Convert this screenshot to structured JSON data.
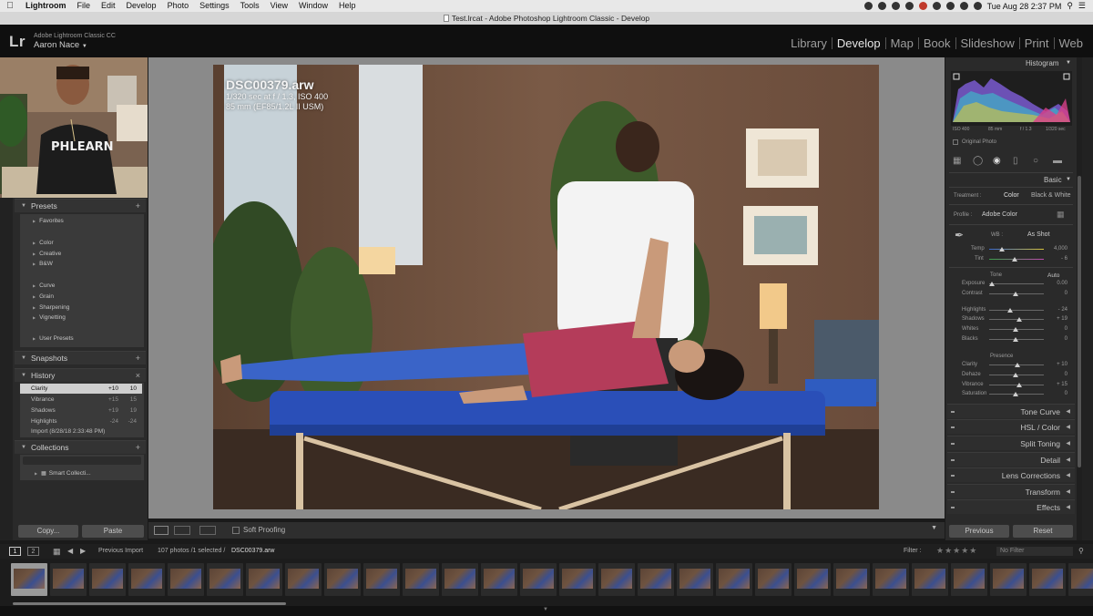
{
  "menubar": {
    "app": "Lightroom",
    "items": [
      "File",
      "Edit",
      "Develop",
      "Photo",
      "Settings",
      "Tools",
      "View",
      "Window",
      "Help"
    ],
    "clock": "Tue Aug 28  2:37 PM"
  },
  "window": {
    "title": "Test.lrcat - Adobe Photoshop Lightroom Classic - Develop"
  },
  "identity": {
    "logo": "Lr",
    "product": "Adobe Lightroom Classic CC",
    "user": "Aaron Nace"
  },
  "modules": [
    {
      "label": "Library",
      "active": false
    },
    {
      "label": "Develop",
      "active": true
    },
    {
      "label": "Map",
      "active": false
    },
    {
      "label": "Book",
      "active": false
    },
    {
      "label": "Slideshow",
      "active": false
    },
    {
      "label": "Print",
      "active": false
    },
    {
      "label": "Web",
      "active": false
    }
  ],
  "left": {
    "presets": {
      "title": "Presets",
      "items": [
        "Favorites",
        "Color",
        "Creative",
        "B&W",
        "Curve",
        "Grain",
        "Sharpening",
        "Vignetting",
        "User Presets"
      ]
    },
    "snapshots": {
      "title": "Snapshots"
    },
    "history": {
      "title": "History",
      "rows": [
        {
          "label": "Clarity",
          "a": "+10",
          "b": "10"
        },
        {
          "label": "Vibrance",
          "a": "+15",
          "b": "15"
        },
        {
          "label": "Shadows",
          "a": "+19",
          "b": "19"
        },
        {
          "label": "Highlights",
          "a": "-24",
          "b": "-24"
        },
        {
          "label": "Import (8/28/18 2:33:48 PM)",
          "a": "",
          "b": ""
        }
      ]
    },
    "collections": {
      "title": "Collections",
      "item": "Smart Collecti..."
    },
    "copy_label": "Copy...",
    "paste_label": "Paste"
  },
  "photo": {
    "filename": "DSC00379.arw",
    "exposure": "1/320 sec at f / 1.3, ISO 400",
    "lens": "85 mm (EF85/1.2L II USM)"
  },
  "toolbar": {
    "soft_proofing": "Soft Proofing"
  },
  "right": {
    "histogram": {
      "title": "Histogram",
      "iso": "ISO 400",
      "focal": "85 mm",
      "aperture": "f / 1.3",
      "shutter": "1/320 sec",
      "original": "Original Photo"
    },
    "basic": {
      "title": "Basic",
      "treatment_label": "Treatment :",
      "color": "Color",
      "bw": "Black & White",
      "profile_label": "Profile :",
      "profile_value": "Adobe Color",
      "wb_label": "WB :",
      "wb_value": "As Shot",
      "temp_label": "Temp",
      "temp_value": "4,000",
      "tint_label": "Tint",
      "tint_value": "- 6",
      "tone_label": "Tone",
      "auto": "Auto",
      "presence_label": "Presence",
      "sliders": [
        {
          "label": "Exposure",
          "value": "0.00"
        },
        {
          "label": "Contrast",
          "value": "0"
        },
        {
          "label": "Highlights",
          "value": "- 24"
        },
        {
          "label": "Shadows",
          "value": "+ 19"
        },
        {
          "label": "Whites",
          "value": "0"
        },
        {
          "label": "Blacks",
          "value": "0"
        },
        {
          "label": "Clarity",
          "value": "+ 10"
        },
        {
          "label": "Dehaze",
          "value": "0"
        },
        {
          "label": "Vibrance",
          "value": "+ 15"
        },
        {
          "label": "Saturation",
          "value": "0"
        }
      ]
    },
    "sections": [
      "Tone Curve",
      "HSL / Color",
      "Split Toning",
      "Detail",
      "Lens Corrections",
      "Transform",
      "Effects"
    ],
    "previous_label": "Previous",
    "reset_label": "Reset"
  },
  "filmstrip": {
    "source": "Previous Import",
    "count": "107 photos /1 selected /",
    "selected_file": "DSC00379.arw",
    "filter_label": "Filter :",
    "filter_value": "No Filter",
    "view1": "1",
    "view2": "2"
  }
}
